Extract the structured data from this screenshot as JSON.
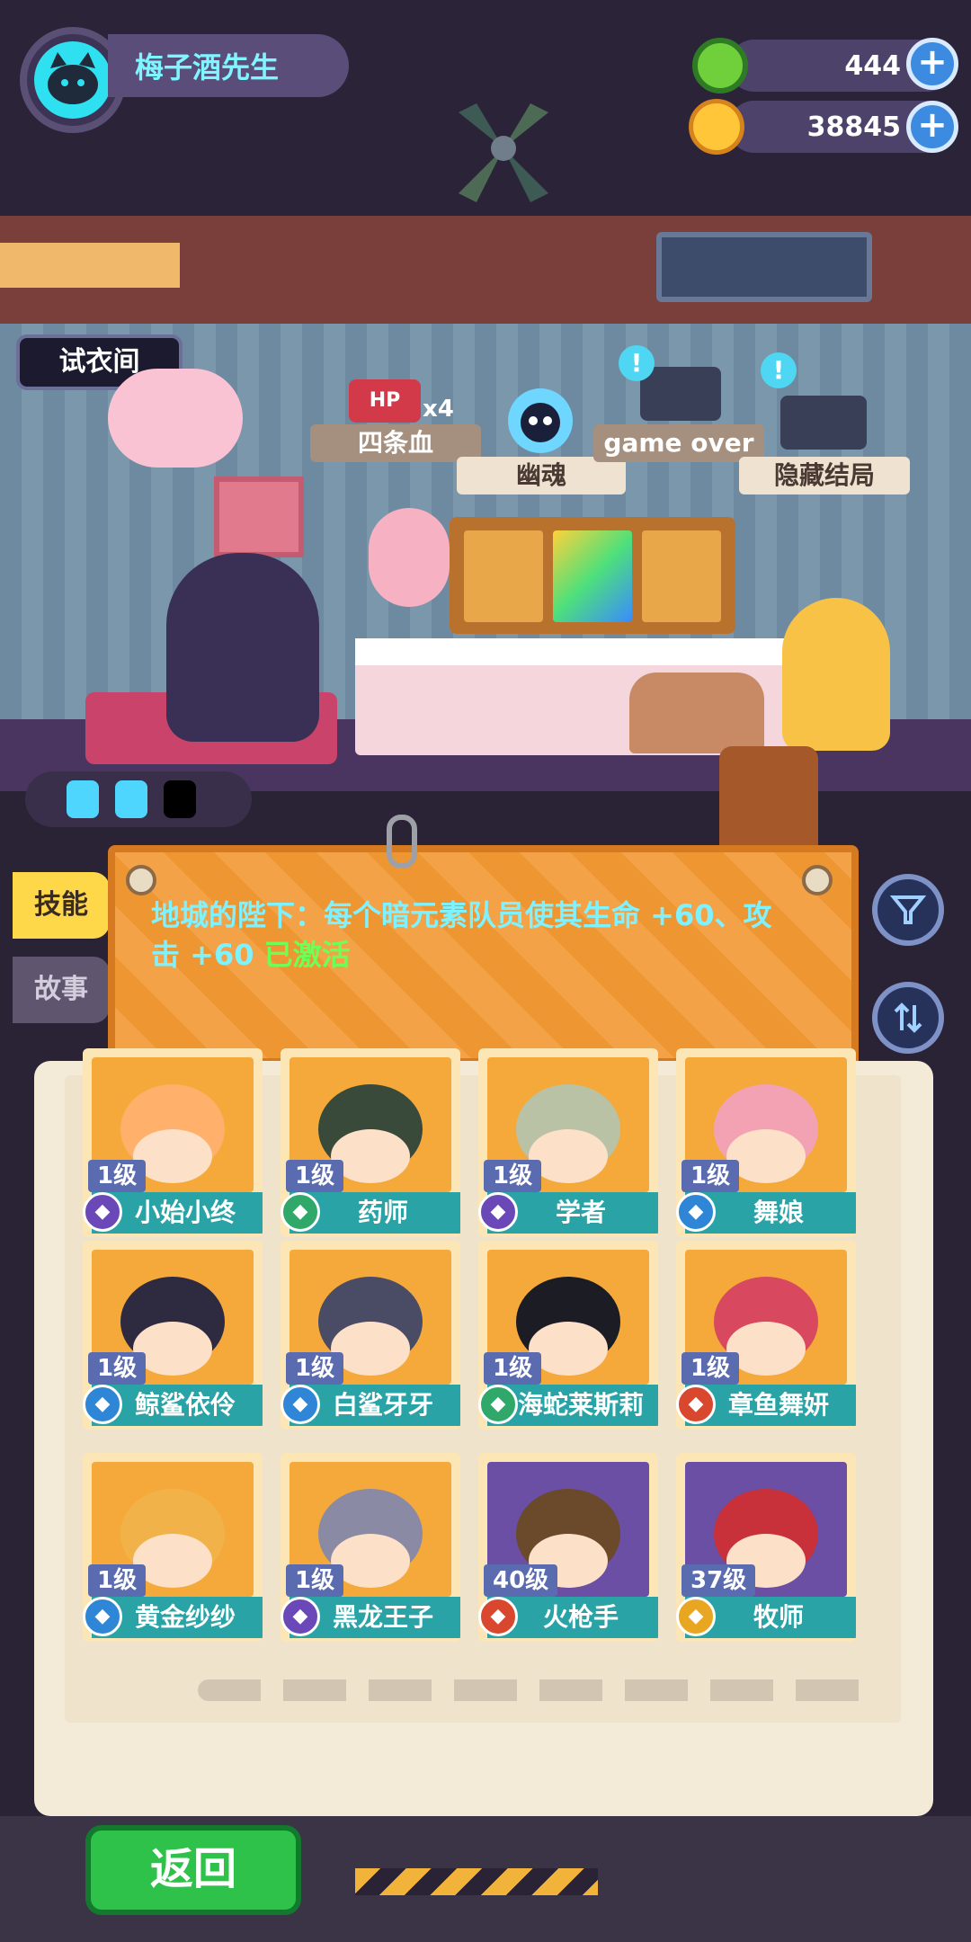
{
  "player": {
    "name": "梅子酒先生"
  },
  "currencies": [
    {
      "icon": "green-gem-icon",
      "value": "444"
    },
    {
      "icon": "gold-coin-icon",
      "value": "38845"
    }
  ],
  "room": {
    "fitting_room_label": "试衣间",
    "hp_badge": "HP",
    "hp_multiplier": "x4",
    "signs": [
      "四条血",
      "幽魂",
      "game over",
      "隐藏结局"
    ]
  },
  "side_tabs": {
    "skill": "技能",
    "story": "故事"
  },
  "skill": {
    "description": "地城的陛下：每个暗元素队员使其生命 +60、攻击 +60",
    "status": "已激活"
  },
  "characters": [
    {
      "level": "1级",
      "name": "小始小终",
      "element": "dark"
    },
    {
      "level": "1级",
      "name": "药师",
      "element": "nature"
    },
    {
      "level": "1级",
      "name": "学者",
      "element": "dark"
    },
    {
      "level": "1级",
      "name": "舞娘",
      "element": "water"
    },
    {
      "level": "1级",
      "name": "鲸鲨依伶",
      "element": "water"
    },
    {
      "level": "1级",
      "name": "白鲨牙牙",
      "element": "water"
    },
    {
      "level": "1级",
      "name": "海蛇莱斯莉",
      "element": "nature"
    },
    {
      "level": "1级",
      "name": "章鱼舞妍",
      "element": "fire"
    },
    {
      "level": "1级",
      "name": "黄金纱纱",
      "element": "water"
    },
    {
      "level": "1级",
      "name": "黑龙王子",
      "element": "dark"
    },
    {
      "level": "40级",
      "name": "火枪手",
      "element": "fire"
    },
    {
      "level": "37级",
      "name": "牧师",
      "element": "light"
    }
  ],
  "bottom": {
    "back_label": "返回"
  },
  "colors": {
    "accent_cyan": "#7ff6ff",
    "status_green": "#6dff58",
    "card_teal": "#2aa3a6",
    "back_green": "#2fc24a"
  }
}
